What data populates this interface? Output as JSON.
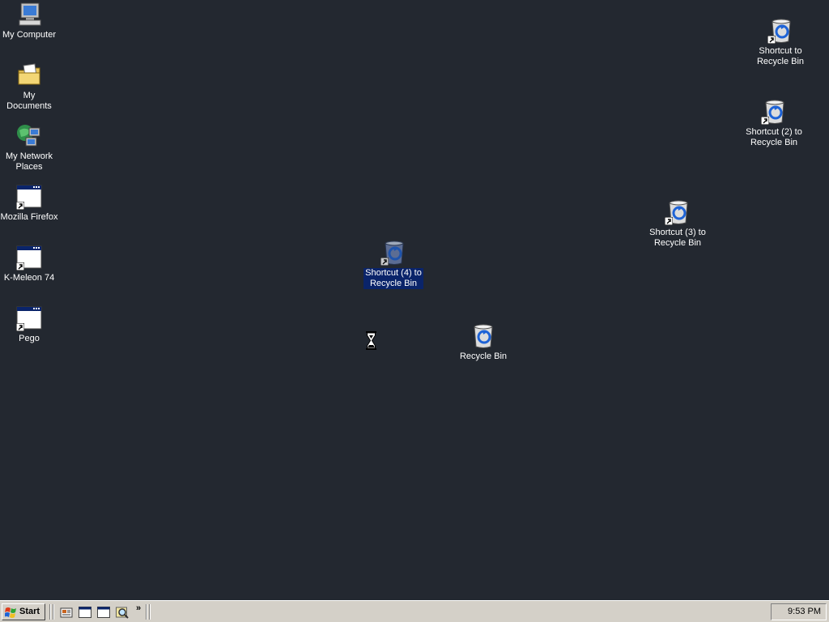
{
  "desktop": {
    "icons": [
      {
        "label": "My Computer",
        "icon": "my-computer-icon"
      },
      {
        "label": "My Documents",
        "icon": "my-documents-icon"
      },
      {
        "label": "My Network\nPlaces",
        "icon": "network-places-icon"
      },
      {
        "label": "Mozilla Firefox",
        "icon": "program-shortcut-icon"
      },
      {
        "label": "K-Meleon 74",
        "icon": "program-shortcut-icon"
      },
      {
        "label": "Pego",
        "icon": "program-shortcut-icon"
      },
      {
        "label": "Shortcut (4) to\nRecycle Bin",
        "icon": "recycle-bin-shortcut-icon",
        "selected": true
      },
      {
        "label": "Recycle Bin",
        "icon": "recycle-bin-icon"
      },
      {
        "label": "Shortcut (3) to\nRecycle Bin",
        "icon": "recycle-bin-shortcut-icon"
      },
      {
        "label": "Shortcut to\nRecycle Bin",
        "icon": "recycle-bin-shortcut-icon"
      },
      {
        "label": "Shortcut (2) to\nRecycle Bin",
        "icon": "recycle-bin-shortcut-icon"
      }
    ]
  },
  "taskbar": {
    "start_label": "Start",
    "quick_launch_more": "»",
    "clock": "9:53 PM"
  },
  "colors": {
    "desktop_background": "#232830",
    "taskbar": "#d4d0c8",
    "selection": "#0a246a"
  }
}
